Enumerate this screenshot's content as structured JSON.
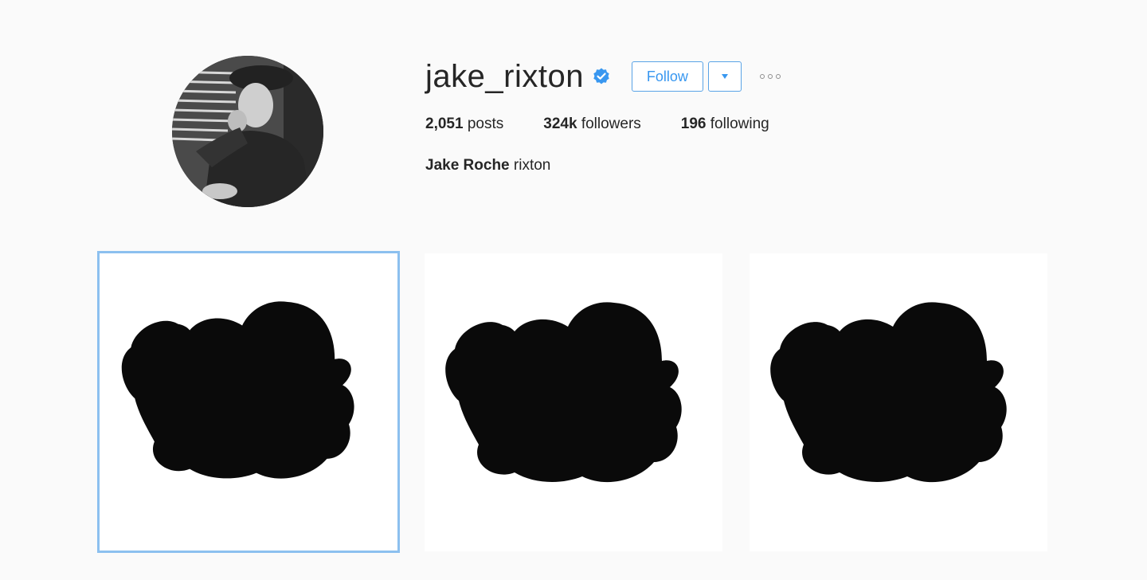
{
  "profile": {
    "username": "jake_rixton",
    "verified": true,
    "verified_icon": "verified-badge-icon",
    "follow_label": "Follow",
    "dropdown_icon": "chevron-down-icon",
    "more_icon": "more-options-icon",
    "accent_color": "#3897f0"
  },
  "stats": {
    "posts_count": "2,051",
    "posts_label": "posts",
    "followers_count": "324k",
    "followers_label": "followers",
    "following_count": "196",
    "following_label": "following"
  },
  "bio": {
    "full_name": "Jake Roche",
    "text": "rixton"
  },
  "posts": [
    {
      "image": "black-cloud-shape",
      "selected": true
    },
    {
      "image": "black-cloud-shape",
      "selected": false
    },
    {
      "image": "black-cloud-shape",
      "selected": false
    }
  ]
}
